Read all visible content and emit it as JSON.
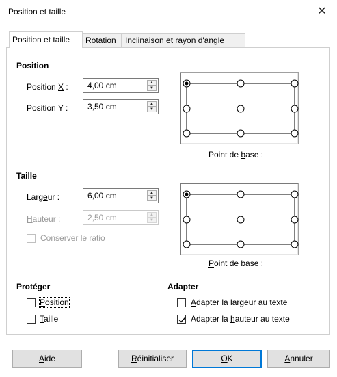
{
  "window": {
    "title": "Position et taille",
    "close_glyph": "✕"
  },
  "tabs": [
    {
      "label": "Position et taille",
      "active": true
    },
    {
      "label": "Rotation",
      "active": false
    },
    {
      "label": "Inclinaison et rayon d'angle",
      "active": false
    }
  ],
  "position": {
    "title": "Position",
    "x": {
      "label_pre": "Position ",
      "label_acc": "X",
      "label_post": " :",
      "value": "4,00 cm"
    },
    "y": {
      "label_pre": "Position ",
      "label_acc": "Y",
      "label_post": " :",
      "value": "3,50 cm"
    },
    "base_point": {
      "label_pre": "Point de ",
      "label_acc": "b",
      "label_post": "ase :",
      "selected": "top-left"
    }
  },
  "size": {
    "title": "Taille",
    "width": {
      "label_pre": "Larg",
      "label_acc": "e",
      "label_post": "ur :",
      "value": "6,00 cm",
      "enabled": true
    },
    "height": {
      "label_pre": "",
      "label_acc": "H",
      "label_post": "auteur :",
      "value": "2,50 cm",
      "enabled": false
    },
    "keep_ratio": {
      "label_pre": "",
      "label_acc": "C",
      "label_post": "onserver le ratio",
      "checked": false,
      "enabled": false
    },
    "base_point": {
      "label_pre": "",
      "label_acc": "P",
      "label_post": "oint de base :",
      "selected": "top-left"
    }
  },
  "protect": {
    "title": "Protéger",
    "position": {
      "label_pre": "",
      "label_acc": "P",
      "label_post": "osition",
      "checked": false
    },
    "size": {
      "label_pre": "",
      "label_acc": "T",
      "label_post": "aille",
      "checked": false
    }
  },
  "fit": {
    "title": "Adapter",
    "width_to_text": {
      "label_pre": "",
      "label_acc": "A",
      "label_post": "dapter la largeur au texte",
      "checked": false
    },
    "height_to_text": {
      "label_pre": "Adapter la ",
      "label_acc": "h",
      "label_post": "auteur au texte",
      "checked": true
    }
  },
  "buttons": {
    "help": {
      "label_pre": "",
      "label_acc": "A",
      "label_post": "ide"
    },
    "reset": {
      "label_pre": "",
      "label_acc": "R",
      "label_post": "éinitialiser"
    },
    "ok": {
      "label_pre": "",
      "label_acc": "O",
      "label_post": "K"
    },
    "cancel": {
      "label_pre": "",
      "label_acc": "A",
      "label_post": "nnuler"
    }
  },
  "colors": {
    "accent": "#0078d7",
    "disabled_text": "#9a9a9a"
  }
}
